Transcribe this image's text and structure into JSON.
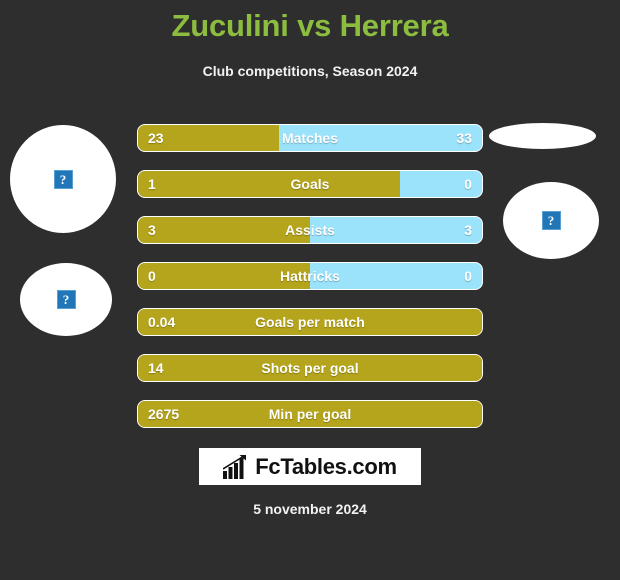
{
  "header": {
    "title": "Zuculini vs Herrera",
    "subtitle": "Club competitions, Season 2024",
    "title_color": "#8cbd3f"
  },
  "theme": {
    "background": "#2e2e2e",
    "left_player_color": "#b5a51c",
    "right_player_color": "#9ae3fb",
    "text_color": "#ffffff"
  },
  "photos": [
    {
      "name": "left-player-photo-top",
      "alt": "?"
    },
    {
      "name": "left-player-photo-bottom",
      "alt": "?"
    },
    {
      "name": "right-player-photo-top",
      "alt": ""
    },
    {
      "name": "right-player-photo-bottom",
      "alt": "?"
    }
  ],
  "chart_data": {
    "type": "bar",
    "title": "Zuculini vs Herrera",
    "subtitle": "Club competitions, Season 2024",
    "orientation": "horizontal-diverging",
    "series": [
      {
        "name": "Zuculini",
        "color": "#b5a51c",
        "side": "left"
      },
      {
        "name": "Herrera",
        "color": "#9ae3fb",
        "side": "right"
      }
    ],
    "categories": [
      "Matches",
      "Goals",
      "Assists",
      "Hattricks",
      "Goals per match",
      "Shots per goal",
      "Min per goal"
    ],
    "rows": [
      {
        "label": "Matches",
        "left_value": "23",
        "right_value": "33",
        "left_pct": 41.1,
        "has_right": true
      },
      {
        "label": "Goals",
        "left_value": "1",
        "right_value": "0",
        "left_pct": 76.3,
        "has_right": true
      },
      {
        "label": "Assists",
        "left_value": "3",
        "right_value": "3",
        "left_pct": 50.0,
        "has_right": true
      },
      {
        "label": "Hattricks",
        "left_value": "0",
        "right_value": "0",
        "left_pct": 50.0,
        "has_right": true
      },
      {
        "label": "Goals per match",
        "left_value": "0.04",
        "right_value": "",
        "left_pct": 100.0,
        "has_right": false
      },
      {
        "label": "Shots per goal",
        "left_value": "14",
        "right_value": "",
        "left_pct": 100.0,
        "has_right": false
      },
      {
        "label": "Min per goal",
        "left_value": "2675",
        "right_value": "",
        "left_pct": 100.0,
        "has_right": false
      }
    ]
  },
  "logo": {
    "text": "FcTables.com",
    "icon": "bar-chart-trend-icon"
  },
  "footer": {
    "date": "5 november 2024"
  }
}
